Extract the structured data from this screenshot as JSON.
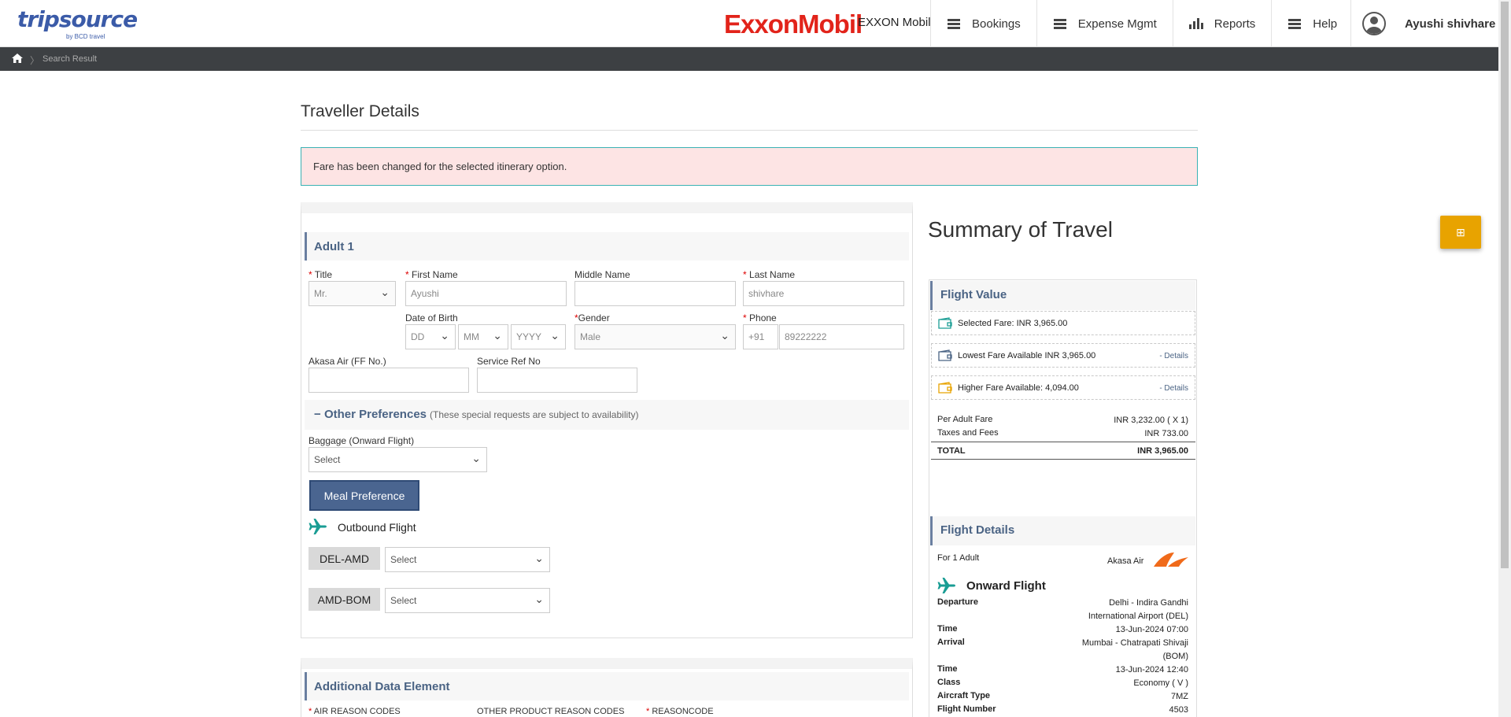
{
  "header": {
    "logo_main": "tripsource",
    "logo_sub": "by BCD travel",
    "brand_logo": "ExxonMobil",
    "company": "EXXON Mobil",
    "nav": [
      {
        "label": "Bookings",
        "icon": "menu-icon"
      },
      {
        "label": "Expense Mgmt",
        "icon": "menu-icon"
      },
      {
        "label": "Reports",
        "icon": "bar-chart-icon"
      },
      {
        "label": "Help",
        "icon": "menu-icon"
      }
    ],
    "user_name": "Ayushi shivhare"
  },
  "breadcrumb": {
    "current": "Search Result"
  },
  "page": {
    "title": "Traveller Details",
    "alert": "Fare has been changed for the selected itinerary option."
  },
  "traveller": {
    "heading": "Adult 1",
    "title_label": "Title",
    "title_value": "Mr.",
    "first_name_label": "First Name",
    "first_name_value": "Ayushi",
    "middle_name_label": "Middle Name",
    "middle_name_value": "",
    "last_name_label": "Last Name",
    "last_name_value": "shivhare",
    "dob_label": "Date of Birth",
    "dob_dd": "DD",
    "dob_mm": "MM",
    "dob_yyyy": "YYYY",
    "gender_label": "Gender",
    "gender_value": "Male",
    "phone_label": "Phone",
    "phone_code": "+91",
    "phone_value": "89222222",
    "ff_label": "Akasa Air (FF No.)",
    "ff_value": "",
    "service_ref_label": "Service Ref No",
    "service_ref_value": ""
  },
  "preferences": {
    "toggle": "−",
    "title": "Other Preferences",
    "note": "(These special requests are subject to availability)",
    "baggage_label": "Baggage (Onward Flight)",
    "baggage_value": "Select",
    "meal_button": "Meal Preference",
    "outbound_label": "Outbound Flight",
    "segments": [
      {
        "code": "DEL-AMD",
        "value": "Select"
      },
      {
        "code": "AMD-BOM",
        "value": "Select"
      }
    ]
  },
  "additional": {
    "heading": "Additional Data Element",
    "fields": [
      "AIR REASON CODES",
      "OTHER PRODUCT REASON CODES",
      "REASONCODE"
    ]
  },
  "summary": {
    "title": "Summary of Travel",
    "fab_icon": "grid-icon",
    "flight_value_heading": "Flight Value",
    "selected_fare": "Selected Fare: INR 3,965.00",
    "lowest_fare_label": "Lowest Fare Available",
    "lowest_fare_value": "INR 3,965.00",
    "higher_fare": "Higher Fare Available: 4,094.00",
    "details_link": "- Details",
    "per_adult_label": "Per Adult Fare",
    "per_adult_value": "INR 3,232.00 ( X 1)",
    "taxes_label": "Taxes and Fees",
    "taxes_value": "INR 733.00",
    "total_label": "TOTAL",
    "total_value": "INR 3,965.00",
    "flight_details_heading": "Flight Details",
    "for_adults": "For 1 Adult",
    "airline": "Akasa Air",
    "onward_flight": "Onward Flight",
    "departure_label": "Departure",
    "departure_value_1": "Delhi - Indira Gandhi",
    "departure_value_2": "International Airport (DEL)",
    "time_label": "Time",
    "departure_time": "13-Jun-2024 07:00",
    "arrival_label": "Arrival",
    "arrival_value_1": "Mumbai - Chatrapati Shivaji",
    "arrival_value_2": "(BOM)",
    "arrival_time": "13-Jun-2024 12:40",
    "class_label": "Class",
    "class_value": "Economy ( V )",
    "aircraft_label": "Aircraft Type",
    "aircraft_value": "7MZ",
    "flight_number_label": "Flight Number",
    "flight_number_value": "4503"
  },
  "colors": {
    "accent": "#4a6384",
    "brand_red": "#e2231a",
    "alert_bg": "#fde4e4",
    "alert_border": "#3ab2b4",
    "fab": "#e8a300",
    "plane": "#1a9d94"
  }
}
